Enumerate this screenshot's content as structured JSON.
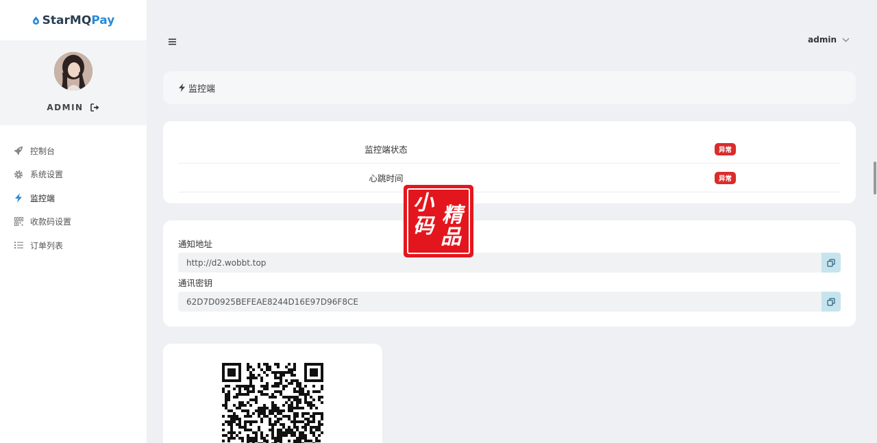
{
  "brand": {
    "name_part1": "StarMQ",
    "name_part2": "Pay"
  },
  "profile": {
    "username": "ADMIN"
  },
  "sidebar": {
    "items": [
      {
        "label": "控制台",
        "icon": "rocket-icon"
      },
      {
        "label": "系统设置",
        "icon": "gear-icon"
      },
      {
        "label": "监控端",
        "icon": "bolt-icon"
      },
      {
        "label": "收款码设置",
        "icon": "qrcode-icon"
      },
      {
        "label": "订单列表",
        "icon": "list-icon"
      }
    ]
  },
  "header": {
    "user": "admin"
  },
  "page": {
    "title": "监控端"
  },
  "status": {
    "rows": [
      {
        "label": "监控端状态",
        "badge": "异常"
      },
      {
        "label": "心跳时间",
        "badge": "异常"
      }
    ]
  },
  "notify": {
    "url_label": "通知地址",
    "url_value": "http://d2.wobbt.top",
    "key_label": "通讯密钥",
    "key_value": "62D7D0925BEFEAE8244D16E97D96F8CE"
  },
  "watermark": {
    "chars": [
      "小",
      "精",
      "码",
      "品"
    ]
  },
  "colors": {
    "accent": "#2a8bd8",
    "danger": "#dc2b2b",
    "copy_button": "#c6e4ee",
    "seal": "#e4161d"
  }
}
